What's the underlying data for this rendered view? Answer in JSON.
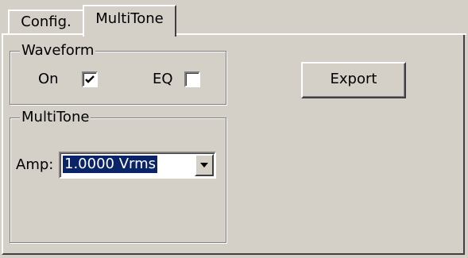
{
  "tabs": [
    {
      "label": "Config.",
      "active": false
    },
    {
      "label": "MultiTone",
      "active": true
    }
  ],
  "waveform": {
    "legend": "Waveform",
    "on_label": "On",
    "on_checked": true,
    "eq_label": "EQ",
    "eq_checked": false
  },
  "export": {
    "label": "Export"
  },
  "multitone": {
    "legend": "MultiTone",
    "amp_label": "Amp:",
    "amp_value": "1.0000 Vrms"
  },
  "icons": {
    "checkmark": "check-icon",
    "dropdown": "chevron-down-icon"
  },
  "colors": {
    "background": "#d4d0c8",
    "selection": "#0a246a",
    "field": "#ffffff"
  }
}
